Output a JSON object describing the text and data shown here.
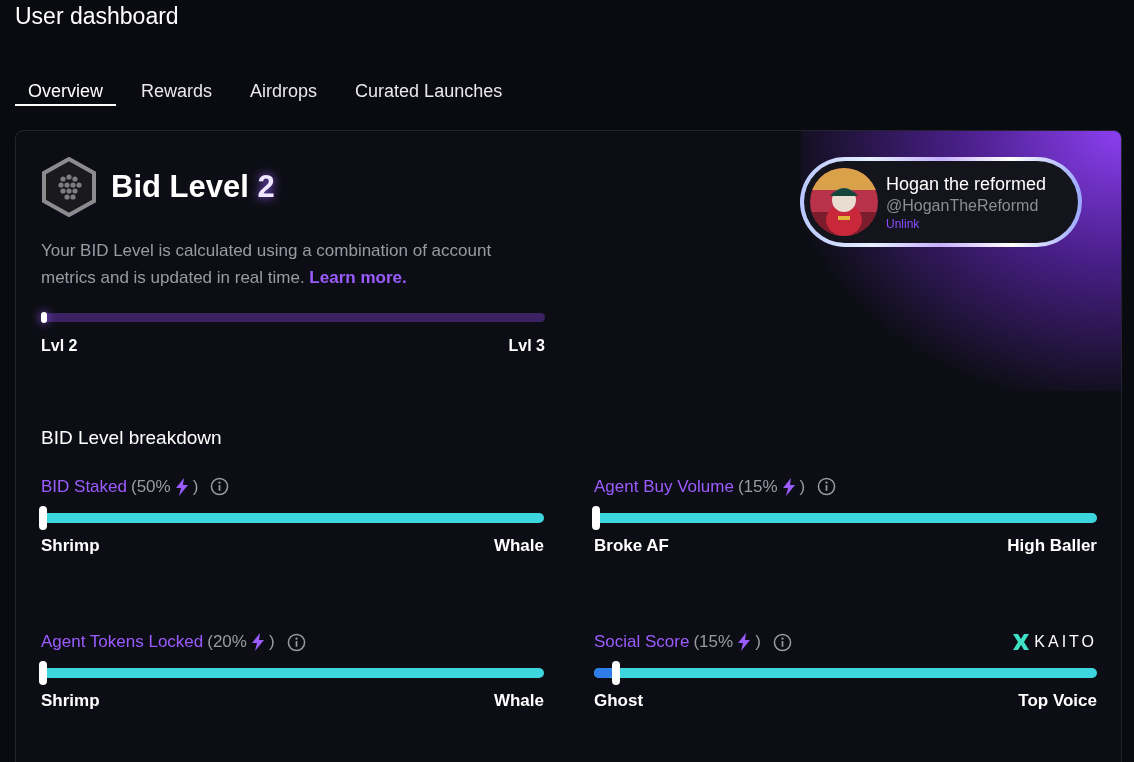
{
  "page": {
    "title": "User dashboard"
  },
  "tabs": [
    {
      "label": "Overview",
      "selected": true
    },
    {
      "label": "Rewards",
      "selected": false
    },
    {
      "label": "Airdrops",
      "selected": false
    },
    {
      "label": "Curated Launches",
      "selected": false
    }
  ],
  "level_card": {
    "title": "Bid Level",
    "level": "2",
    "description": "Your BID Level is calculated using a combination of account metrics and is updated in real time.",
    "link": "Learn more.",
    "progress": {
      "level": 0,
      "start": "Lvl 2",
      "end": "Lvl 3"
    }
  },
  "profile": {
    "name": "Hogan the reformed",
    "handle": "@HoganTheReformd",
    "action": "Unlink"
  },
  "breakdown": {
    "title": "BID Level breakdown",
    "metrics": [
      {
        "name": "BID Staked",
        "weight": "(50%",
        "close": ")",
        "level": 0,
        "low": "Shrimp",
        "high": "Whale"
      },
      {
        "name": "Agent Buy Volume",
        "weight": "(15%",
        "close": ")",
        "level": 0,
        "low": "Broke AF",
        "high": "High Baller"
      },
      {
        "name": "Agent Tokens Locked",
        "weight": "(20%",
        "close": ")",
        "level": 0,
        "low": "Shrimp",
        "high": "Whale"
      },
      {
        "name": "Social Score",
        "weight": "(15%",
        "close": ")",
        "level": 0.04,
        "low": "Ghost",
        "high": "Top Voice",
        "partner": "KAITO"
      }
    ]
  }
}
